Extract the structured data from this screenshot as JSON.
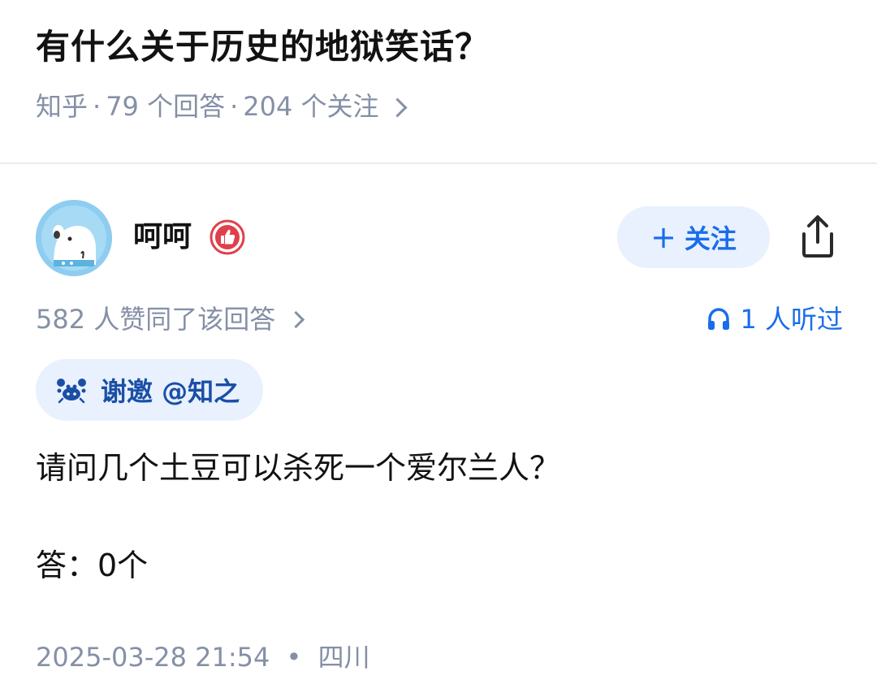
{
  "question": {
    "title": "有什么关于历史的地狱笑话？",
    "source": "知乎",
    "answers_count": "79 个回答",
    "followers_count": "204 个关注",
    "separator": "·"
  },
  "author": {
    "name": "呵呵",
    "follow_label": "关注",
    "follow_plus": "+"
  },
  "stats": {
    "upvotes": "582 人赞同了该回答",
    "listened": "1 人听过"
  },
  "invite": {
    "label": "谢邀 @知之"
  },
  "answer": {
    "lines": [
      "请问几个土豆可以杀死一个爱尔兰人？",
      "答：0个"
    ],
    "date": "2025-03-28 21:54",
    "location": "四川",
    "footer_sep": "•"
  },
  "colors": {
    "brand_blue": "#1a6dea",
    "chip_bg": "#e8f1fd",
    "meta_gray": "#8590a6",
    "badge_red": "#e0404b"
  },
  "icons": {
    "avatar": "cartoon-dog-avatar",
    "badge": "thumbs-up-badge-icon",
    "share": "share-icon",
    "listen": "headphones-icon",
    "invite": "crab-icon",
    "chevron": "chevron-right-icon"
  }
}
